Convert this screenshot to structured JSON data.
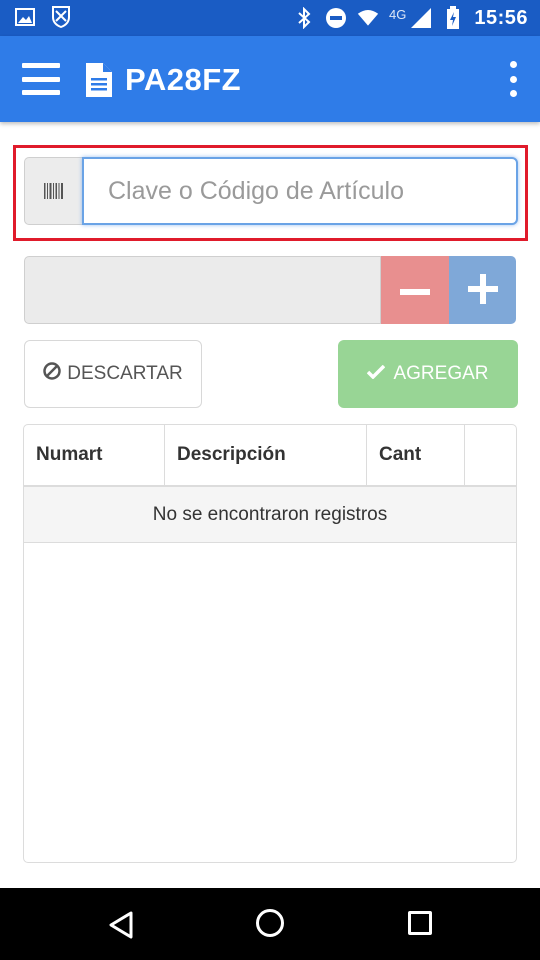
{
  "status_bar": {
    "time": "15:56",
    "network": "4G",
    "icons": [
      "image-icon",
      "shield-icon",
      "bluetooth-icon",
      "do-not-disturb-icon",
      "wifi-icon",
      "signal-icon",
      "battery-icon"
    ]
  },
  "app_bar": {
    "title": "PA28FZ",
    "menu_icon": "hamburger-icon",
    "title_icon": "document-icon",
    "overflow_icon": "more-vert-icon"
  },
  "search": {
    "placeholder": "Clave o Código de Artículo",
    "value": "",
    "addon_icon": "barcode-icon",
    "highlight_color": "#e01b2b"
  },
  "quantity": {
    "value": "",
    "minus_icon": "minus-icon",
    "plus_icon": "plus-icon"
  },
  "actions": {
    "discard_label": "DESCARTAR",
    "discard_icon": "ban-icon",
    "add_label": "AGREGAR",
    "add_icon": "check-icon"
  },
  "table": {
    "columns": [
      "Numart",
      "Descripción",
      "Cant",
      ""
    ],
    "empty_message": "No se encontraron registros"
  },
  "colors": {
    "app_bar": "#2f7ce8",
    "status_bar": "#1a5cc4",
    "minus_button": "#e88f8f",
    "plus_button": "#7fa8d8",
    "add_button": "#98d595"
  }
}
